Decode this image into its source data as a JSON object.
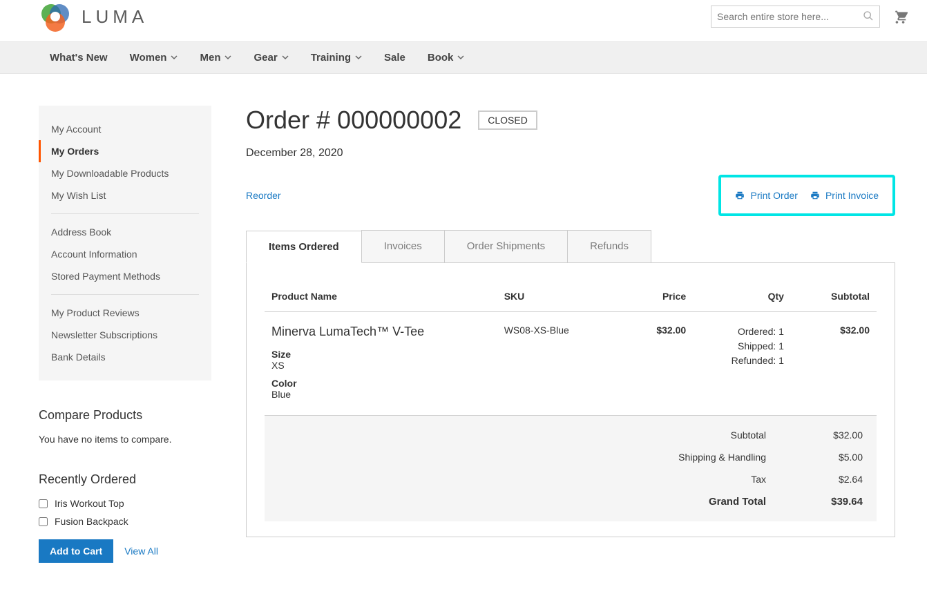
{
  "brand": {
    "name": "LUMA"
  },
  "search": {
    "placeholder": "Search entire store here..."
  },
  "nav": {
    "items": [
      {
        "label": "What's New",
        "chev": false
      },
      {
        "label": "Women",
        "chev": true
      },
      {
        "label": "Men",
        "chev": true
      },
      {
        "label": "Gear",
        "chev": true
      },
      {
        "label": "Training",
        "chev": true
      },
      {
        "label": "Sale",
        "chev": false
      },
      {
        "label": "Book",
        "chev": true
      }
    ]
  },
  "sidebar": {
    "account_nav": [
      {
        "label": "My Account"
      },
      {
        "label": "My Orders",
        "current": true
      },
      {
        "label": "My Downloadable Products"
      },
      {
        "label": "My Wish List"
      },
      {
        "sep": true
      },
      {
        "label": "Address Book"
      },
      {
        "label": "Account Information"
      },
      {
        "label": "Stored Payment Methods"
      },
      {
        "sep": true
      },
      {
        "label": "My Product Reviews"
      },
      {
        "label": "Newsletter Subscriptions"
      },
      {
        "label": "Bank Details"
      }
    ],
    "compare": {
      "title": "Compare Products",
      "msg": "You have no items to compare."
    },
    "recent": {
      "title": "Recently Ordered",
      "items": [
        {
          "label": "Iris Workout Top"
        },
        {
          "label": "Fusion Backpack"
        }
      ],
      "add_btn": "Add to Cart",
      "view_all": "View All"
    }
  },
  "order": {
    "title": "Order # 000000002",
    "status": "Closed",
    "date": "December 28, 2020",
    "reorder": "Reorder",
    "print_order": "Print Order",
    "print_invoice": "Print Invoice",
    "tabs": [
      {
        "label": "Items Ordered",
        "active": true
      },
      {
        "label": "Invoices"
      },
      {
        "label": "Order Shipments"
      },
      {
        "label": "Refunds"
      }
    ],
    "columns": {
      "product": "Product Name",
      "sku": "SKU",
      "price": "Price",
      "qty": "Qty",
      "subtotal": "Subtotal"
    },
    "items": [
      {
        "name": "Minerva LumaTech™ V-Tee",
        "sku": "WS08-XS-Blue",
        "price": "$32.00",
        "qty_lines": [
          "Ordered: 1",
          "Shipped: 1",
          "Refunded: 1"
        ],
        "subtotal": "$32.00",
        "options": [
          {
            "label": "Size",
            "value": "XS"
          },
          {
            "label": "Color",
            "value": "Blue"
          }
        ]
      }
    ],
    "totals": [
      {
        "label": "Subtotal",
        "value": "$32.00"
      },
      {
        "label": "Shipping & Handling",
        "value": "$5.00"
      },
      {
        "label": "Tax",
        "value": "$2.64"
      },
      {
        "label": "Grand Total",
        "value": "$39.64",
        "grand": true
      }
    ]
  }
}
